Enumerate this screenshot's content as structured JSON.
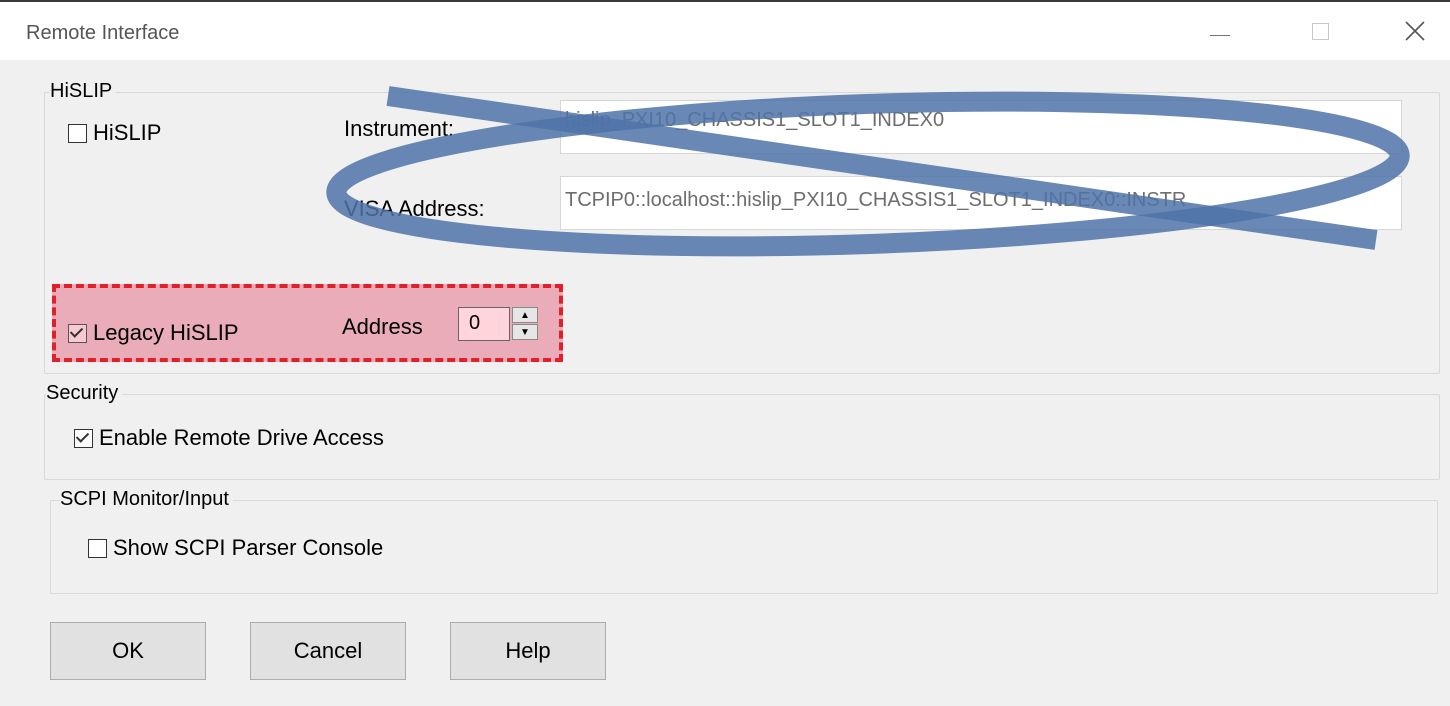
{
  "window": {
    "title": "Remote Interface",
    "controls": {
      "minimize": "—",
      "maximize": "",
      "close": "✕"
    }
  },
  "hislip_group": {
    "title": "HiSLIP",
    "hislip_checkbox": {
      "label": "HiSLIP",
      "checked": false
    },
    "instrument": {
      "label": "Instrument:",
      "value": "hislip_PXI10_CHASSIS1_SLOT1_INDEX0"
    },
    "visa_address": {
      "label": "VISA Address:",
      "value": "TCPIP0::localhost::hislip_PXI10_CHASSIS1_SLOT1_INDEX0::INSTR"
    },
    "legacy_checkbox": {
      "label": "Legacy HiSLIP",
      "checked": true
    },
    "address": {
      "label": "Address",
      "value": "0"
    }
  },
  "security_group": {
    "title": "Security",
    "remote_drive_checkbox": {
      "label": "Enable Remote Drive Access",
      "checked": true
    }
  },
  "scpi_group": {
    "title": "SCPI Monitor/Input",
    "console_checkbox": {
      "label": "Show SCPI Parser Console",
      "checked": false
    }
  },
  "buttons": {
    "ok": "OK",
    "cancel": "Cancel",
    "help": "Help"
  },
  "annotations": {
    "highlight_color": "#e0202a",
    "ellipse_color": "#4f73a8"
  }
}
